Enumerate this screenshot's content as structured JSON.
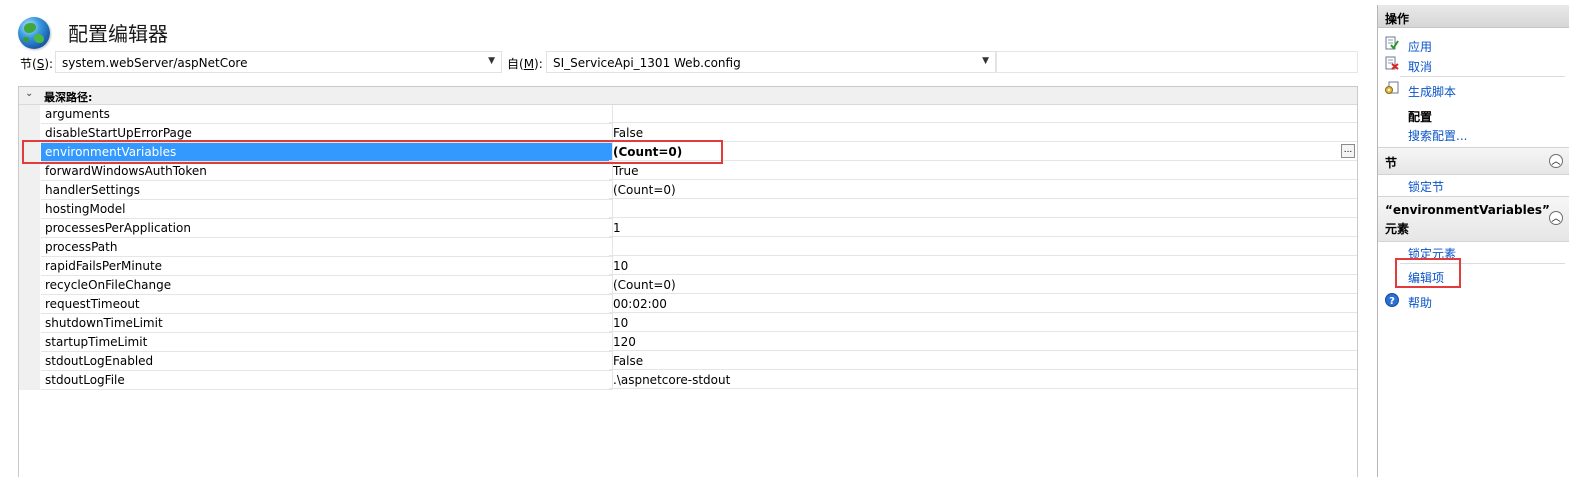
{
  "header": {
    "title": "配置编辑器"
  },
  "section": {
    "label_pre": "节(",
    "label_key": "S",
    "label_post": "):",
    "value": "system.webServer/aspNetCore"
  },
  "from": {
    "label_pre": "自(",
    "label_key": "M",
    "label_post": "):",
    "value": "SI_ServiceApi_1301 Web.config"
  },
  "grid": {
    "header": "最深路径:",
    "rows": [
      {
        "name": "arguments",
        "value": ""
      },
      {
        "name": "disableStartUpErrorPage",
        "value": "False"
      },
      {
        "name": "environmentVariables",
        "value": "(Count=0)",
        "selected": true
      },
      {
        "name": "forwardWindowsAuthToken",
        "value": "True"
      },
      {
        "name": "handlerSettings",
        "value": "(Count=0)"
      },
      {
        "name": "hostingModel",
        "value": ""
      },
      {
        "name": "processesPerApplication",
        "value": "1"
      },
      {
        "name": "processPath",
        "value": ""
      },
      {
        "name": "rapidFailsPerMinute",
        "value": "10"
      },
      {
        "name": "recycleOnFileChange",
        "value": "(Count=0)"
      },
      {
        "name": "requestTimeout",
        "value": "00:02:00"
      },
      {
        "name": "shutdownTimeLimit",
        "value": "10"
      },
      {
        "name": "startupTimeLimit",
        "value": "120"
      },
      {
        "name": "stdoutLogEnabled",
        "value": "False"
      },
      {
        "name": "stdoutLogFile",
        "value": ".\\aspnetcore-stdout"
      }
    ],
    "ellipsis_label": "..."
  },
  "actions": {
    "title": "操作",
    "apply": "应用",
    "cancel": "取消",
    "generate_script": "生成脚本",
    "config_heading": "配置",
    "search_config": "搜索配置...",
    "section_heading": "节",
    "lock_section": "锁定节",
    "element_heading_line1": "“environmentVariables”",
    "element_heading_line2": "元素",
    "lock_element": "锁定元素",
    "edit_items": "编辑项",
    "help": "帮助"
  },
  "colors": {
    "selection": "#3399ff",
    "link": "#0a54c8",
    "highlight_box": "#e23b3b"
  }
}
